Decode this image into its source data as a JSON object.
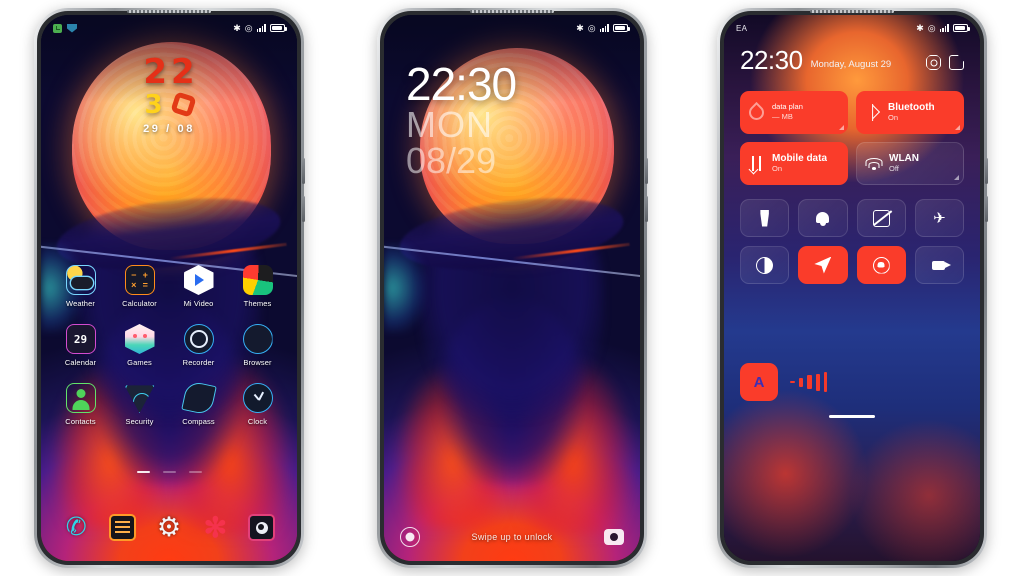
{
  "phones": [
    {
      "id": "home-screen",
      "statusbar": {
        "left_icons": [
          "notification-icon",
          "shield-icon"
        ],
        "right_icons": [
          "bluetooth-icon",
          "location-icon",
          "signal-icon",
          "battery-icon"
        ],
        "carrier": ""
      },
      "clock_widget": {
        "hour_d1": "2",
        "hour_d2": "2",
        "minute_d1": "3",
        "minute_d2": "0",
        "date": "29 / 08"
      },
      "apps": [
        [
          {
            "label": "Weather",
            "icon": "weather-icon"
          },
          {
            "label": "Calculator",
            "icon": "calculator-icon"
          },
          {
            "label": "Mi Video",
            "icon": "mi-video-icon"
          },
          {
            "label": "Themes",
            "icon": "themes-icon"
          }
        ],
        [
          {
            "label": "Calendar",
            "icon": "calendar-icon",
            "badge": "29"
          },
          {
            "label": "Games",
            "icon": "games-icon"
          },
          {
            "label": "Recorder",
            "icon": "recorder-icon"
          },
          {
            "label": "Browser",
            "icon": "browser-icon"
          }
        ],
        [
          {
            "label": "Contacts",
            "icon": "contacts-icon"
          },
          {
            "label": "Security",
            "icon": "security-icon"
          },
          {
            "label": "Compass",
            "icon": "compass-icon"
          },
          {
            "label": "Clock",
            "icon": "clock-icon"
          }
        ]
      ],
      "page_indicator": {
        "pages": 3,
        "active": 1
      },
      "dock": [
        {
          "name": "phone-app",
          "icon": "phone-icon"
        },
        {
          "name": "messages-app",
          "icon": "message-icon"
        },
        {
          "name": "settings-app",
          "icon": "gear-icon"
        },
        {
          "name": "gallery-app",
          "icon": "flower-icon"
        },
        {
          "name": "camera-app",
          "icon": "camera-icon"
        }
      ]
    },
    {
      "id": "lock-screen",
      "statusbar": {
        "right_icons": [
          "bluetooth-icon",
          "location-icon",
          "signal-icon",
          "battery-icon"
        ]
      },
      "clock": {
        "time": "22:30",
        "weekday": "MON",
        "date": "08/29"
      },
      "bottom": {
        "left_shortcut": "voice-assistant-icon",
        "hint": "Swipe up to unlock",
        "right_shortcut": "camera-icon"
      }
    },
    {
      "id": "control-center",
      "statusbar": {
        "carrier": "EA",
        "right_icons": [
          "bluetooth-icon",
          "location-icon",
          "signal-icon",
          "battery-icon"
        ]
      },
      "header": {
        "time": "22:30",
        "date": "Monday, August 29",
        "settings_icon": "gear-icon",
        "edit_icon": "edit-icon"
      },
      "tiles": [
        {
          "title": "data plan",
          "subtitle": "— MB",
          "icon": "data-drop-icon",
          "state": "on",
          "small_title": true
        },
        {
          "title": "Bluetooth",
          "subtitle": "On",
          "icon": "bluetooth-icon",
          "state": "on",
          "small_title": false
        },
        {
          "title": "Mobile data",
          "subtitle": "On",
          "icon": "mobile-data-icon",
          "state": "on",
          "small_title": false
        },
        {
          "title": "WLAN",
          "subtitle": "Off",
          "icon": "wifi-icon",
          "state": "off",
          "small_title": false
        }
      ],
      "quick_toggles": [
        {
          "name": "flashlight-toggle",
          "icon": "flashlight-icon",
          "state": "off"
        },
        {
          "name": "ring-toggle",
          "icon": "bell-icon",
          "state": "off"
        },
        {
          "name": "cast-toggle",
          "icon": "cast-off-icon",
          "state": "off"
        },
        {
          "name": "airplane-mode-toggle",
          "icon": "airplane-icon",
          "state": "off"
        },
        {
          "name": "dark-mode-toggle",
          "icon": "dark-mode-icon",
          "state": "off"
        },
        {
          "name": "location-toggle",
          "icon": "location-icon",
          "state": "on"
        },
        {
          "name": "rotation-lock-toggle",
          "icon": "rotation-lock-icon",
          "state": "on"
        },
        {
          "name": "screen-recorder-toggle",
          "icon": "video-camera-icon",
          "state": "off"
        }
      ],
      "brightness": {
        "auto_label": "A",
        "auto_state": "on"
      }
    }
  ],
  "colors": {
    "accent_red": "#fa3c2a",
    "widget_hour": "#e53018",
    "widget_minute": "#ffd21c",
    "screen_dark": "#05060f"
  }
}
